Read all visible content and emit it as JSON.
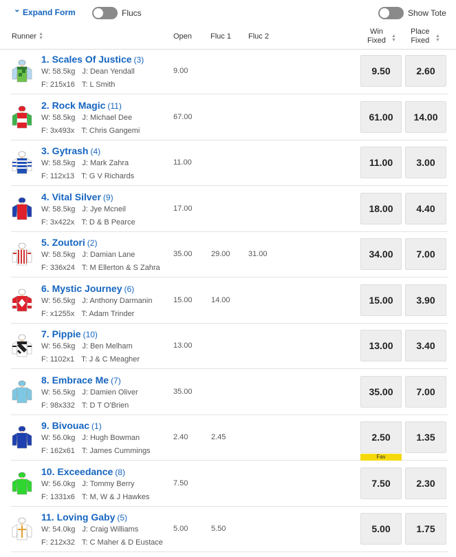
{
  "topbar": {
    "expand_label": "Expand Form",
    "flucs_label": "Flucs",
    "tote_label": "Show Tote"
  },
  "header": {
    "runner": "Runner",
    "open": "Open",
    "fluc1": "Fluc 1",
    "fluc2": "Fluc 2",
    "win_line1": "Win",
    "win_line2": "Fixed",
    "place_line1": "Place",
    "place_line2": "Fixed"
  },
  "runners": [
    {
      "name": "1. Scales Of Justice",
      "barrier": "(3)",
      "weight": "W: 58.5kg",
      "jockey": "J: Dean Yendall",
      "form": "F: 215x16",
      "trainer": "T: L Smith",
      "open": "9.00",
      "fluc1": "",
      "fluc2": "",
      "win": "9.50",
      "place": "2.60",
      "fav": "",
      "silk": {
        "top": "#2e7d32",
        "body": "#6cc24a",
        "sleeve": "#b3d9f2",
        "cap": "#b3d9f2",
        "pattern": "check"
      }
    },
    {
      "name": "2. Rock Magic",
      "barrier": "(11)",
      "weight": "W: 58.5kg",
      "jockey": "J: Michael Dee",
      "form": "F: 3x493x",
      "trainer": "T: Chris Gangemi",
      "open": "67.00",
      "fluc1": "",
      "fluc2": "",
      "win": "61.00",
      "place": "14.00",
      "fav": "",
      "silk": {
        "top": "#e0202a",
        "body": "#e0202a",
        "sleeve": "#3cb44b",
        "cap": "#e0202a",
        "pattern": "band"
      }
    },
    {
      "name": "3. Gytrash",
      "barrier": "(4)",
      "weight": "W: 58.5kg",
      "jockey": "J: Mark Zahra",
      "form": "F: 112x13",
      "trainer": "T: G V Richards",
      "open": "11.00",
      "fluc1": "",
      "fluc2": "",
      "win": "11.00",
      "place": "3.00",
      "fav": "",
      "silk": {
        "top": "#1e4fb5",
        "body": "#1e4fb5",
        "sleeve": "#ffffff",
        "cap": "#ffffff",
        "pattern": "hoops"
      }
    },
    {
      "name": "4. Vital Silver",
      "barrier": "(9)",
      "weight": "W: 58.5kg",
      "jockey": "J: Jye Mcneil",
      "form": "F: 3x422x",
      "trainer": "T: D & B Pearce",
      "open": "17.00",
      "fluc1": "",
      "fluc2": "",
      "win": "18.00",
      "place": "4.40",
      "fav": "",
      "silk": {
        "top": "#e0202a",
        "body": "#e0202a",
        "sleeve": "#1e40b0",
        "cap": "#1e40b0",
        "pattern": "plain"
      }
    },
    {
      "name": "5. Zoutori",
      "barrier": "(2)",
      "weight": "W: 58.5kg",
      "jockey": "J: Damian Lane",
      "form": "F: 336x24",
      "trainer": "T: M Ellerton & S Zahra",
      "open": "35.00",
      "fluc1": "29.00",
      "fluc2": "31.00",
      "win": "34.00",
      "place": "7.00",
      "fav": "",
      "silk": {
        "top": "#ffffff",
        "body": "#ffffff",
        "sleeve": "#ffffff",
        "cap": "#ffffff",
        "pattern": "stripes"
      }
    },
    {
      "name": "6. Mystic Journey",
      "barrier": "(6)",
      "weight": "W: 56.5kg",
      "jockey": "J: Anthony Darmanin",
      "form": "F: x1255x",
      "trainer": "T: Adam Trinder",
      "open": "15.00",
      "fluc1": "14.00",
      "fluc2": "",
      "win": "15.00",
      "place": "3.90",
      "fav": "",
      "silk": {
        "top": "#e0202a",
        "body": "#e0202a",
        "sleeve": "#e0202a",
        "cap": "#ffffff",
        "pattern": "diamond"
      }
    },
    {
      "name": "7. Pippie",
      "barrier": "(10)",
      "weight": "W: 56.5kg",
      "jockey": "J: Ben Melham",
      "form": "F: 1102x1",
      "trainer": "T: J & C Meagher",
      "open": "13.00",
      "fluc1": "",
      "fluc2": "",
      "win": "13.00",
      "place": "3.40",
      "fav": "",
      "silk": {
        "top": "#222222",
        "body": "#ffffff",
        "sleeve": "#ffffff",
        "cap": "#ffffff",
        "pattern": "diagonal"
      }
    },
    {
      "name": "8. Embrace Me",
      "barrier": "(7)",
      "weight": "W: 56.5kg",
      "jockey": "J: Damien Oliver",
      "form": "F: 98x332",
      "trainer": "T: D T O'Brien",
      "open": "35.00",
      "fluc1": "",
      "fluc2": "",
      "win": "35.00",
      "place": "7.00",
      "fav": "",
      "silk": {
        "top": "#7ec8e3",
        "body": "#7ec8e3",
        "sleeve": "#7ec8e3",
        "cap": "#7ec8e3",
        "pattern": "plain"
      }
    },
    {
      "name": "9. Bivouac",
      "barrier": "(1)",
      "weight": "W: 56.0kg",
      "jockey": "J: Hugh Bowman",
      "form": "F: 162x61",
      "trainer": "T: James Cummings",
      "open": "2.40",
      "fluc1": "2.45",
      "fluc2": "",
      "win": "2.50",
      "place": "1.35",
      "fav": "Fav",
      "silk": {
        "top": "#1e40b0",
        "body": "#1e40b0",
        "sleeve": "#1e40b0",
        "cap": "#1e40b0",
        "pattern": "plain"
      }
    },
    {
      "name": "10. Exceedance",
      "barrier": "(8)",
      "weight": "W: 56.0kg",
      "jockey": "J: Tommy Berry",
      "form": "F: 1331x6",
      "trainer": "T: M, W & J Hawkes",
      "open": "7.50",
      "fluc1": "",
      "fluc2": "",
      "win": "7.50",
      "place": "2.30",
      "fav": "",
      "silk": {
        "top": "#2fd62f",
        "body": "#2fd62f",
        "sleeve": "#2fd62f",
        "cap": "#2fd62f",
        "pattern": "plain"
      }
    },
    {
      "name": "11. Loving Gaby",
      "barrier": "(5)",
      "weight": "W: 54.0kg",
      "jockey": "J: Craig Williams",
      "form": "F: 212x32",
      "trainer": "T: C Maher & D Eustace",
      "open": "5.00",
      "fluc1": "5.50",
      "fluc2": "",
      "win": "5.00",
      "place": "1.75",
      "fav": "",
      "silk": {
        "top": "#ffffff",
        "body": "#ffffff",
        "sleeve": "#ffffff",
        "cap": "#ffffff",
        "pattern": "cross"
      }
    }
  ]
}
